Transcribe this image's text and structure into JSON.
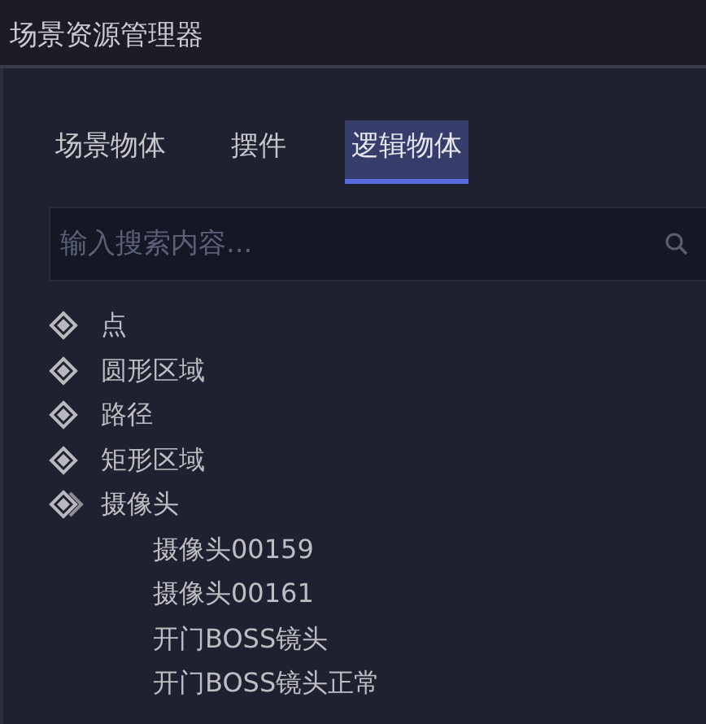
{
  "window": {
    "title": "场景资源管理器"
  },
  "tabs": [
    {
      "label": "场景物体",
      "selected": false
    },
    {
      "label": "摆件",
      "selected": false
    },
    {
      "label": "逻辑物体",
      "selected": true
    }
  ],
  "search": {
    "placeholder": "输入搜索内容..."
  },
  "tree": [
    {
      "label": "点",
      "expanded": false
    },
    {
      "label": "圆形区域",
      "expanded": false
    },
    {
      "label": "路径",
      "expanded": false
    },
    {
      "label": "矩形区域",
      "expanded": false
    },
    {
      "label": "摄像头",
      "expanded": true,
      "children": [
        {
          "label": "摄像头00159"
        },
        {
          "label": "摄像头00161"
        },
        {
          "label": "开门BOSS镜头"
        },
        {
          "label": "开门BOSS镜头正常"
        }
      ]
    }
  ]
}
